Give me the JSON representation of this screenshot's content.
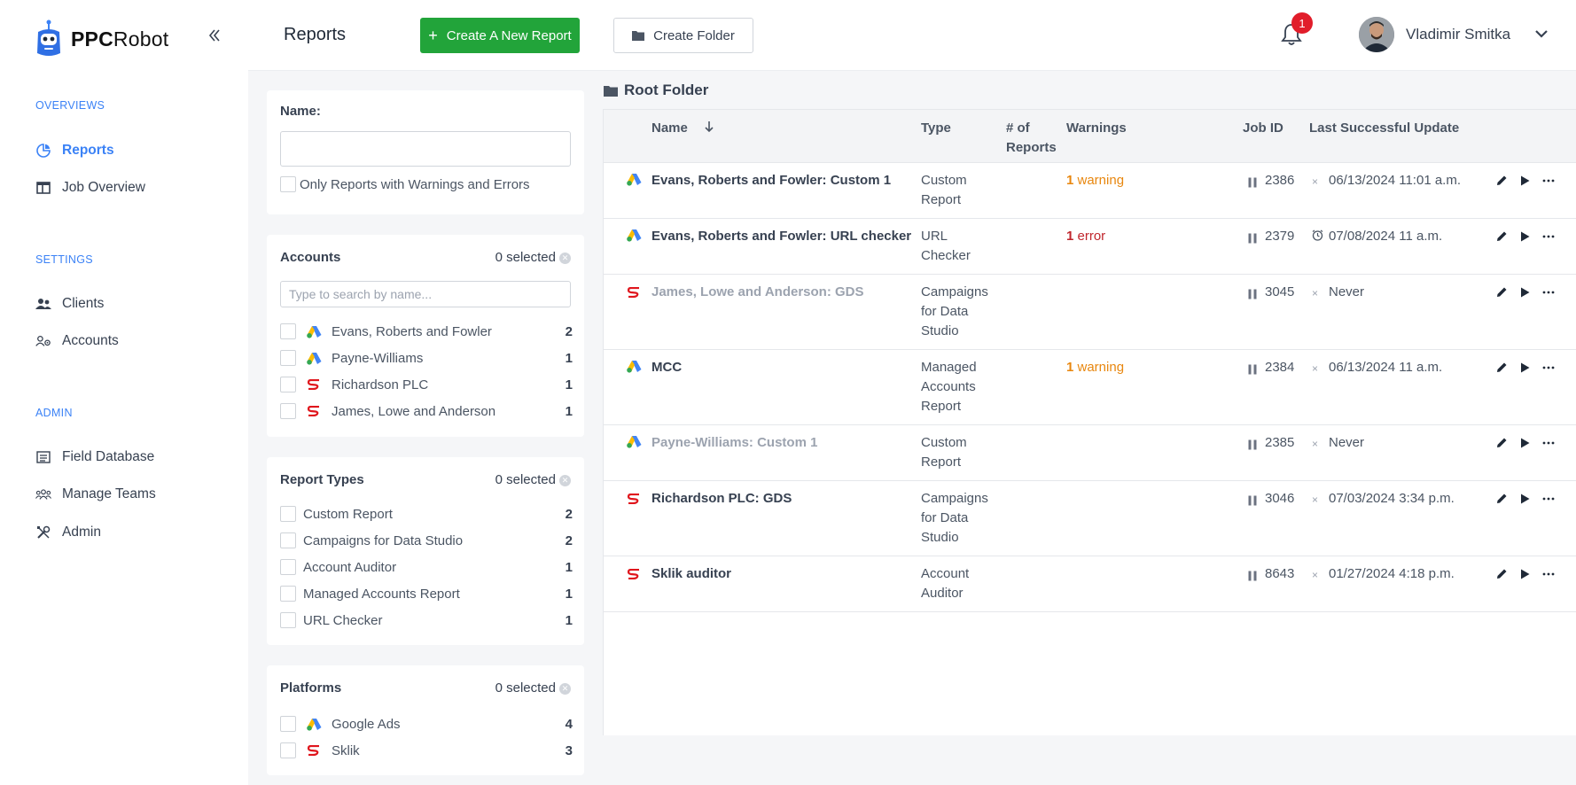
{
  "brand": {
    "name_bold": "PPC",
    "name_rest": "Robot"
  },
  "sidebar": {
    "sections": [
      {
        "title": "OVERVIEWS",
        "items": [
          {
            "label": "Reports",
            "icon": "pie-chart-icon",
            "active": true
          },
          {
            "label": "Job Overview",
            "icon": "columns-icon"
          }
        ]
      },
      {
        "title": "SETTINGS",
        "items": [
          {
            "label": "Clients",
            "icon": "users-icon"
          },
          {
            "label": "Accounts",
            "icon": "user-gear-icon"
          }
        ]
      },
      {
        "title": "ADMIN",
        "items": [
          {
            "label": "Field Database",
            "icon": "list-icon"
          },
          {
            "label": "Manage Teams",
            "icon": "team-icon"
          },
          {
            "label": "Admin",
            "icon": "tools-icon"
          }
        ]
      }
    ]
  },
  "header": {
    "title": "Reports",
    "create_report": "Create A New Report",
    "create_folder": "Create Folder",
    "notifications": "1",
    "user_name": "Vladimir Smitka"
  },
  "filters": {
    "name": {
      "label": "Name:",
      "value": "",
      "warnings_only": "Only Reports with Warnings and Errors"
    },
    "accounts": {
      "label": "Accounts",
      "selected": "0 selected",
      "search_placeholder": "Type to search by name...",
      "items": [
        {
          "name": "Evans, Roberts and Fowler",
          "platform": "google-ads-icon",
          "count": "2"
        },
        {
          "name": "Payne-Williams",
          "platform": "google-ads-icon",
          "count": "1"
        },
        {
          "name": "Richardson PLC",
          "platform": "sklik-icon",
          "count": "1"
        },
        {
          "name": "James, Lowe and Anderson",
          "platform": "sklik-icon",
          "count": "1"
        }
      ]
    },
    "report_types": {
      "label": "Report Types",
      "selected": "0 selected",
      "items": [
        {
          "name": "Custom Report",
          "count": "2"
        },
        {
          "name": "Campaigns for Data Studio",
          "count": "2"
        },
        {
          "name": "Account Auditor",
          "count": "1"
        },
        {
          "name": "Managed Accounts Report",
          "count": "1"
        },
        {
          "name": "URL Checker",
          "count": "1"
        }
      ]
    },
    "platforms": {
      "label": "Platforms",
      "selected": "0 selected",
      "items": [
        {
          "name": "Google Ads",
          "platform": "google-ads-icon",
          "count": "4"
        },
        {
          "name": "Sklik",
          "platform": "sklik-icon",
          "count": "3"
        }
      ]
    }
  },
  "table": {
    "folder": "Root Folder",
    "columns": {
      "name": "Name",
      "type": "Type",
      "reports_1": "# of",
      "reports_2": "Reports",
      "warnings": "Warnings",
      "job_id": "Job ID",
      "last_update": "Last Successful Update"
    },
    "rows": [
      {
        "platform": "google-ads-icon",
        "name": "Evans, Roberts and Fowler: Custom 1",
        "dim": false,
        "type": [
          "Custom",
          "Report"
        ],
        "warn_num": "1",
        "warn_text": " warning",
        "warn_kind": "orange",
        "job_id": "2386",
        "status": "x",
        "last_update": "06/13/2024 11:01 a.m."
      },
      {
        "platform": "google-ads-icon",
        "name": "Evans, Roberts and Fowler: URL checker",
        "dim": false,
        "type": [
          "URL",
          "Checker"
        ],
        "warn_num": "1",
        "warn_text": " error",
        "warn_kind": "red",
        "job_id": "2379",
        "status": "clock",
        "last_update": "07/08/2024 11 a.m."
      },
      {
        "platform": "sklik-icon",
        "name": "James, Lowe and Anderson: GDS",
        "dim": true,
        "type": [
          "Campaigns",
          "for Data",
          "Studio"
        ],
        "warn_num": "",
        "warn_text": "",
        "warn_kind": "",
        "job_id": "3045",
        "status": "x",
        "last_update": "Never"
      },
      {
        "platform": "google-ads-icon",
        "name": "MCC",
        "dim": false,
        "type": [
          "Managed",
          "Accounts",
          "Report"
        ],
        "warn_num": "1",
        "warn_text": " warning",
        "warn_kind": "orange",
        "job_id": "2384",
        "status": "x",
        "last_update": "06/13/2024 11 a.m."
      },
      {
        "platform": "google-ads-icon",
        "name": "Payne-Williams: Custom 1",
        "dim": true,
        "type": [
          "Custom",
          "Report"
        ],
        "warn_num": "",
        "warn_text": "",
        "warn_kind": "",
        "job_id": "2385",
        "status": "x",
        "last_update": "Never"
      },
      {
        "platform": "sklik-icon",
        "name": "Richardson PLC: GDS",
        "dim": false,
        "type": [
          "Campaigns",
          "for Data",
          "Studio"
        ],
        "warn_num": "",
        "warn_text": "",
        "warn_kind": "",
        "job_id": "3046",
        "status": "x",
        "last_update": "07/03/2024 3:34 p.m."
      },
      {
        "platform": "sklik-icon",
        "name": "Sklik auditor",
        "dim": false,
        "type": [
          "Account",
          "Auditor"
        ],
        "warn_num": "",
        "warn_text": "",
        "warn_kind": "",
        "job_id": "8643",
        "status": "x",
        "last_update": "01/27/2024 4:18 p.m."
      }
    ]
  },
  "colors": {
    "accent": "#3b82f6",
    "primary_button": "#22a43a",
    "warning": "#e8870f",
    "error": "#c0262d",
    "badge": "#e11d2a"
  }
}
